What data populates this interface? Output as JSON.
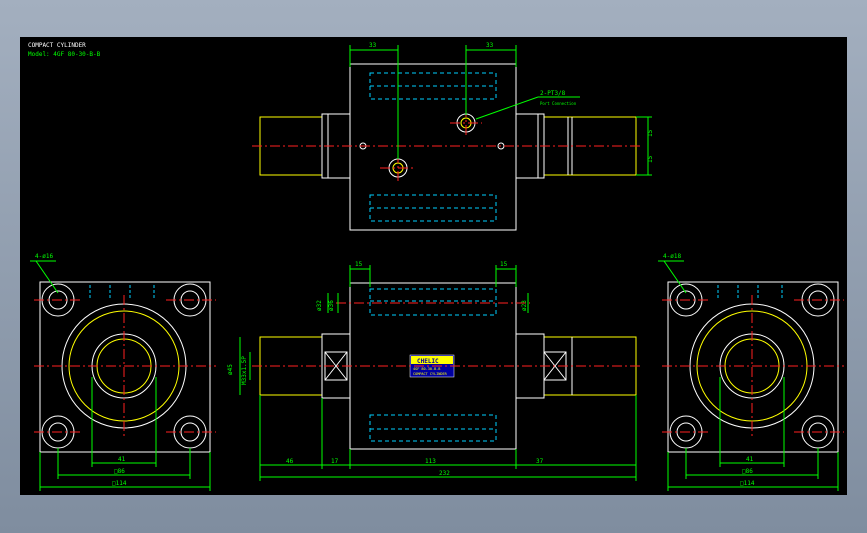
{
  "title_block": {
    "title": "COMPACT CYLINDER",
    "model": "Model: 4GF 80-30-B-B"
  },
  "top_view": {
    "dim_left": "33",
    "dim_right": "33",
    "port_label": "2-PT3/8",
    "port_note": "Port Connection",
    "dim_v1": "15",
    "dim_v2": "15"
  },
  "front_view": {
    "dim_top_left": "15",
    "dim_top_right": "15",
    "dia_left": "ø32",
    "dia_left2": "ø36",
    "dia_right": "ø23",
    "dia_vert": "ø45",
    "thread": "M33x1.5P",
    "dim_46": "46",
    "dim_17": "17",
    "dim_113": "113",
    "dim_37": "37",
    "dim_232": "232",
    "nameplate_brand": "CHELIC",
    "nameplate_line1": "4GF 80-30-B-B",
    "nameplate_line2": "COMPACT CYLINDER"
  },
  "left_view": {
    "holes": "4-ø16",
    "dim_41": "41",
    "dim_86": "□86",
    "dim_114": "□114"
  },
  "right_view": {
    "holes": "4-ø18",
    "dim_41": "41",
    "dim_86": "□86",
    "dim_114": "□114"
  },
  "colors": {
    "outline": "#ffffff",
    "yellow": "#ffff00",
    "hidden": "#00d0ff",
    "center": "#ff2020",
    "dimension": "#00ff00"
  }
}
